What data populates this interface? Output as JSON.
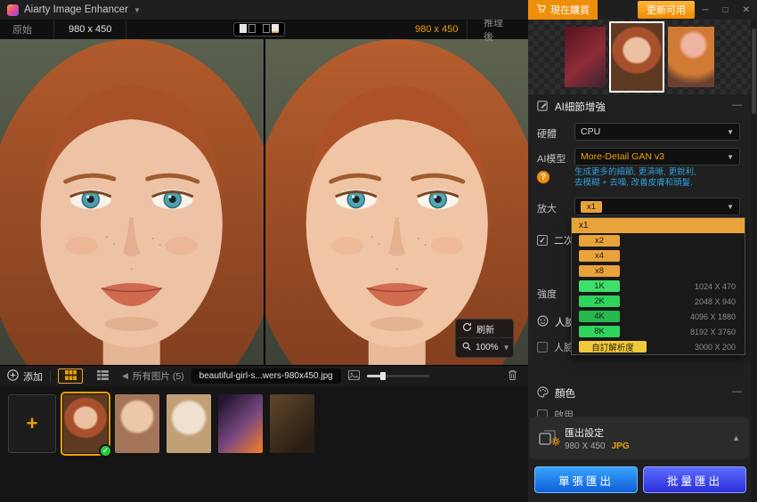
{
  "titlebar": {
    "app_title": "Aiarty Image Enhancer",
    "buy_button": "現在購買",
    "update_button": "更新可用"
  },
  "compare_bar": {
    "original_label": "原始",
    "original_size": "980 x 450",
    "enhanced_size": "980 x 450",
    "enhanced_label": "推理後"
  },
  "viewer": {
    "refresh_label": "刷新",
    "zoom_value": "100%"
  },
  "film_bar": {
    "add_label": "添加",
    "all_images_label": "所有图片 (5)",
    "filename": "beautiful-girl-s...wers-980x450.jpg"
  },
  "panel": {
    "ai_section_title": "AI細節增強",
    "hardware_label": "硬體",
    "hardware_value": "CPU",
    "model_label": "AI模型",
    "model_value": "More-Detail GAN  v3",
    "model_hint_line1": "生成更多的細節, 更清晰, 更銳利,",
    "model_hint_line2": "去模糊 + 去噪, 改善皮膚和頭髮.",
    "upscale_label": "放大",
    "upscale_value": "x1",
    "secondary_label": "二次",
    "strength_label": "強度",
    "face_section_title": "人臉",
    "face_checkbox_label": "人臉",
    "color_section_title": "顏色",
    "enable_label": "啟用",
    "export_title": "匯出設定",
    "export_size": "980 X 450",
    "export_format": "JPG",
    "single_export_button": "單張匯出",
    "batch_export_button": "批量匯出"
  },
  "upscale_dropdown": {
    "items": [
      {
        "label": "x1",
        "value": "",
        "kind": "scale",
        "selected": true
      },
      {
        "label": "x2",
        "value": "",
        "kind": "scale"
      },
      {
        "label": "x4",
        "value": "",
        "kind": "scale"
      },
      {
        "label": "x8",
        "value": "",
        "kind": "scale"
      },
      {
        "label": "1K",
        "value": "1024 X 470",
        "kind": "resolution"
      },
      {
        "label": "2K",
        "value": "2048 X 940",
        "kind": "resolution"
      },
      {
        "label": "4K",
        "value": "4096 X 1880",
        "kind": "resolution"
      },
      {
        "label": "8K",
        "value": "8192 X 3760",
        "kind": "resolution"
      },
      {
        "label": "自訂解析度",
        "value": "3000 X 200",
        "kind": "custom"
      }
    ]
  },
  "colors": {
    "accent_orange": "#f0a000",
    "pill_amber": "#e8a33b",
    "pill_green": "#2fd45c",
    "pill_yellow": "#f0c93c",
    "hint_teal": "#2d9fd8",
    "button_blue": "#1d7bf5",
    "check_green": "#27c93f"
  }
}
